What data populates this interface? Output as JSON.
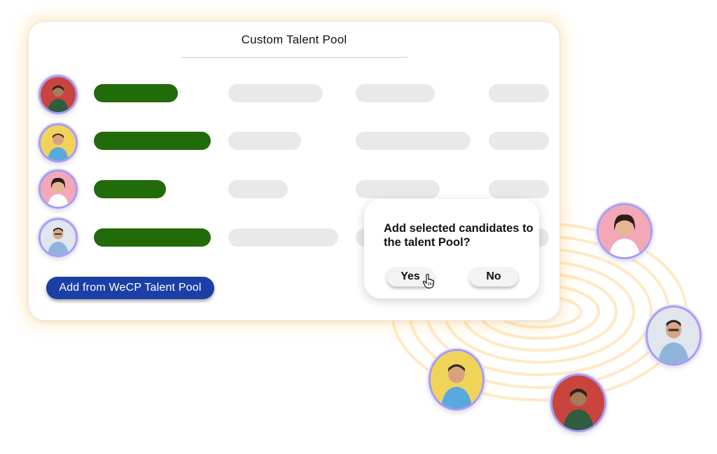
{
  "card": {
    "title": "Custom Talent Pool",
    "add_button_label": "Add from WeCP Talent Pool"
  },
  "dialog": {
    "question": "Add selected candidates to the talent Pool?",
    "yes_label": "Yes",
    "no_label": "No"
  },
  "colors": {
    "accent_green": "#226b0b",
    "button_blue": "#1b3fa6",
    "avatar_ring": "#a79cf3",
    "glow": "#ffc45a"
  },
  "icons": {
    "cursor": "hand-pointer-icon"
  }
}
